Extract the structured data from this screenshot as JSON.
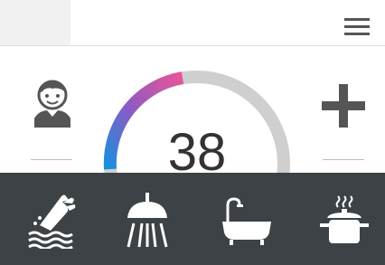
{
  "temperature": {
    "value": "38"
  },
  "colors": {
    "gauge_track": "#cfcfcf",
    "gauge_gradient": [
      "#1a8fe0",
      "#8a5bc4",
      "#e0559c"
    ],
    "bottom_bar": "#3c4245",
    "icon": "#ffffff",
    "plus": "#555555"
  },
  "icons": {
    "menu": "hamburger-menu-icon",
    "user": "user-avatar-icon",
    "increase": "plus-icon",
    "modes": [
      "hand-wash-icon",
      "shower-icon",
      "bathtub-icon",
      "cooking-pot-icon"
    ]
  }
}
